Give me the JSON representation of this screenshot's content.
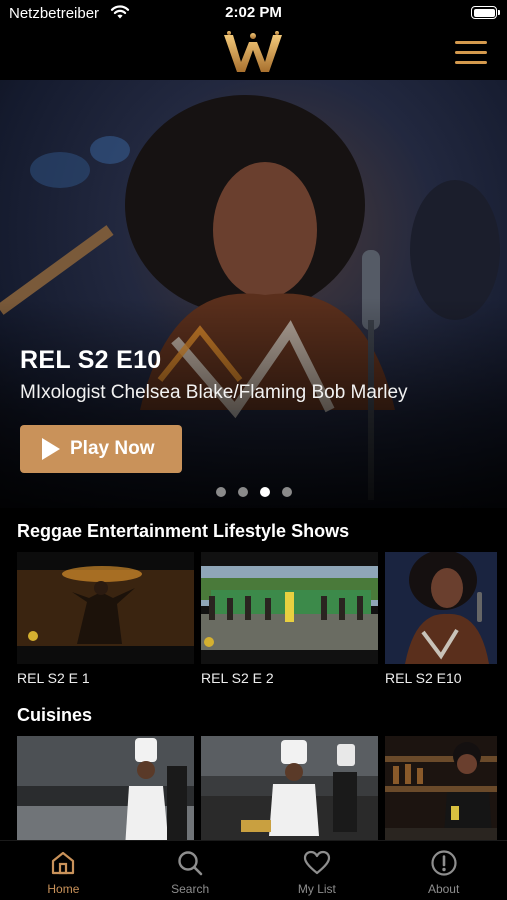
{
  "status_bar": {
    "carrier": "Netzbetreiber",
    "time": "2:02 PM"
  },
  "header": {
    "logo_icon": "w-crown-logo",
    "menu_icon": "hamburger-menu-icon",
    "accent": "#d49a4e"
  },
  "hero": {
    "title": "REL S2 E10",
    "subtitle": "MIxologist Chelsea Blake/Flaming Bob Marley",
    "play_label": "Play Now",
    "slide_count": 4,
    "active_slide": 3
  },
  "sections": [
    {
      "title": "Reggae Entertainment Lifestyle Shows",
      "items": [
        {
          "label": "REL S2 E 1"
        },
        {
          "label": "REL S2 E 2"
        },
        {
          "label": "REL S2 E10"
        }
      ]
    },
    {
      "title": "Cuisines",
      "items": [
        {
          "label": ""
        },
        {
          "label": ""
        },
        {
          "label": ""
        }
      ]
    }
  ],
  "tabs": [
    {
      "label": "Home",
      "icon": "home-icon",
      "active": true
    },
    {
      "label": "Search",
      "icon": "search-icon",
      "active": false
    },
    {
      "label": "My List",
      "icon": "heart-icon",
      "active": false
    },
    {
      "label": "About",
      "icon": "info-icon",
      "active": false
    }
  ],
  "colors": {
    "accent": "#c9925a",
    "inactive_tab": "#8e8e8e",
    "background": "#000000"
  }
}
